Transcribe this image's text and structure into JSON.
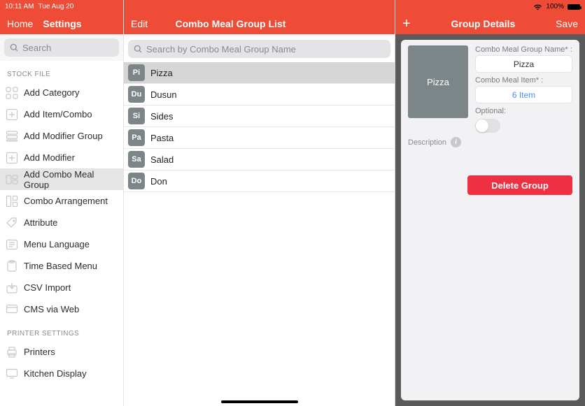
{
  "statusbar": {
    "time": "10:11 AM",
    "date": "Tue Aug 20",
    "battery_pct": "100%"
  },
  "left": {
    "home": "Home",
    "settings": "Settings",
    "search_placeholder": "Search",
    "section1": "STOCK FILE",
    "items1": [
      "Add Category",
      "Add Item/Combo",
      "Add Modifier Group",
      "Add Modifier",
      "Add Combo Meal Group",
      "Combo Arrangement",
      "Attribute",
      "Menu Language",
      "Time Based Menu",
      "CSV Import",
      "CMS via Web"
    ],
    "section2": "PRINTER SETTINGS",
    "items2": [
      "Printers",
      "Kitchen Display"
    ]
  },
  "mid": {
    "edit": "Edit",
    "title": "Combo Meal Group List",
    "search_placeholder": "Search by Combo Meal Group Name",
    "groups": [
      {
        "abbr": "Pi",
        "name": "Pizza",
        "selected": true
      },
      {
        "abbr": "Du",
        "name": "Dusun"
      },
      {
        "abbr": "Si",
        "name": "Sides"
      },
      {
        "abbr": "Pa",
        "name": "Pasta"
      },
      {
        "abbr": "Sa",
        "name": "Salad"
      },
      {
        "abbr": "Do",
        "name": "Don"
      }
    ]
  },
  "right": {
    "plus": "+",
    "title": "Group Details",
    "save": "Save",
    "thumb_label": "Pizza",
    "name_label": "Combo Meal Group Name* :",
    "name_value": "Pizza",
    "item_label": "Combo Meal Item* :",
    "item_value": "6 Item",
    "optional_label": "Optional:",
    "description_label": "Description",
    "delete": "Delete Group"
  }
}
